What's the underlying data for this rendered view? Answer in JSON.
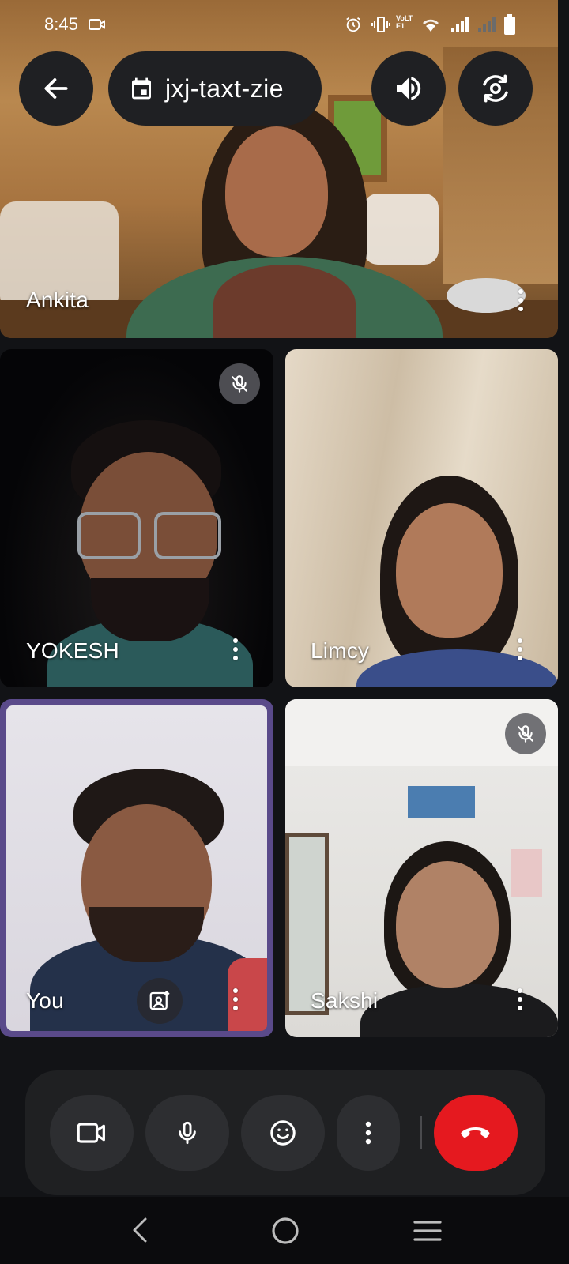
{
  "status_bar": {
    "time": "8:45",
    "network_label": "VoLTE1"
  },
  "header": {
    "meeting_code": "jxj-taxt-zie"
  },
  "participants": [
    {
      "name": "Ankita",
      "muted": false
    },
    {
      "name": "YOKESH",
      "muted": true
    },
    {
      "name": "Limcy",
      "muted": false
    },
    {
      "name": "You",
      "muted": false,
      "self": true
    },
    {
      "name": "Sakshi",
      "muted": true
    }
  ],
  "controls": {
    "camera": "camera-icon",
    "mic": "mic-icon",
    "reactions": "emoji-icon",
    "more": "more-vertical-icon",
    "end_call": "end-call-icon"
  },
  "colors": {
    "end_call": "#e5191f",
    "self_tile_border": "#5a4a8a",
    "control_bg": "#2d2e31",
    "bar_bg": "#1f2022"
  }
}
